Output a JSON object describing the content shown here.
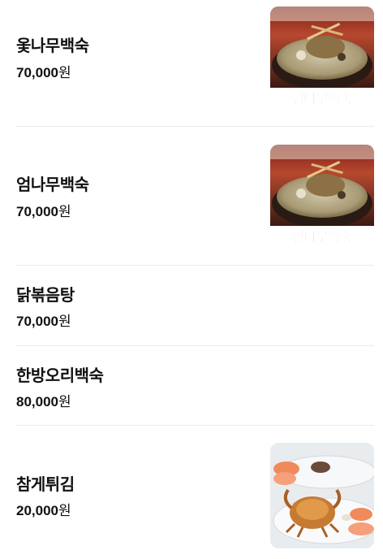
{
  "menu": [
    {
      "name": "옻나무백숙",
      "price": "70,000",
      "unit": "원",
      "image": "herbal-chicken-soup",
      "image_caption": "엄나무백숙"
    },
    {
      "name": "엄나무백숙",
      "price": "70,000",
      "unit": "원",
      "image": "herbal-chicken-soup",
      "image_caption": "엄나무백숙"
    },
    {
      "name": "닭볶음탕",
      "price": "70,000",
      "unit": "원"
    },
    {
      "name": "한방오리백숙",
      "price": "80,000",
      "unit": "원"
    },
    {
      "name": "참게튀김",
      "price": "20,000",
      "unit": "원",
      "image": "fried-crab-plate"
    }
  ],
  "colors": {
    "text": "#111111",
    "divider": "#ececec",
    "caption_red": "#d8141a"
  }
}
